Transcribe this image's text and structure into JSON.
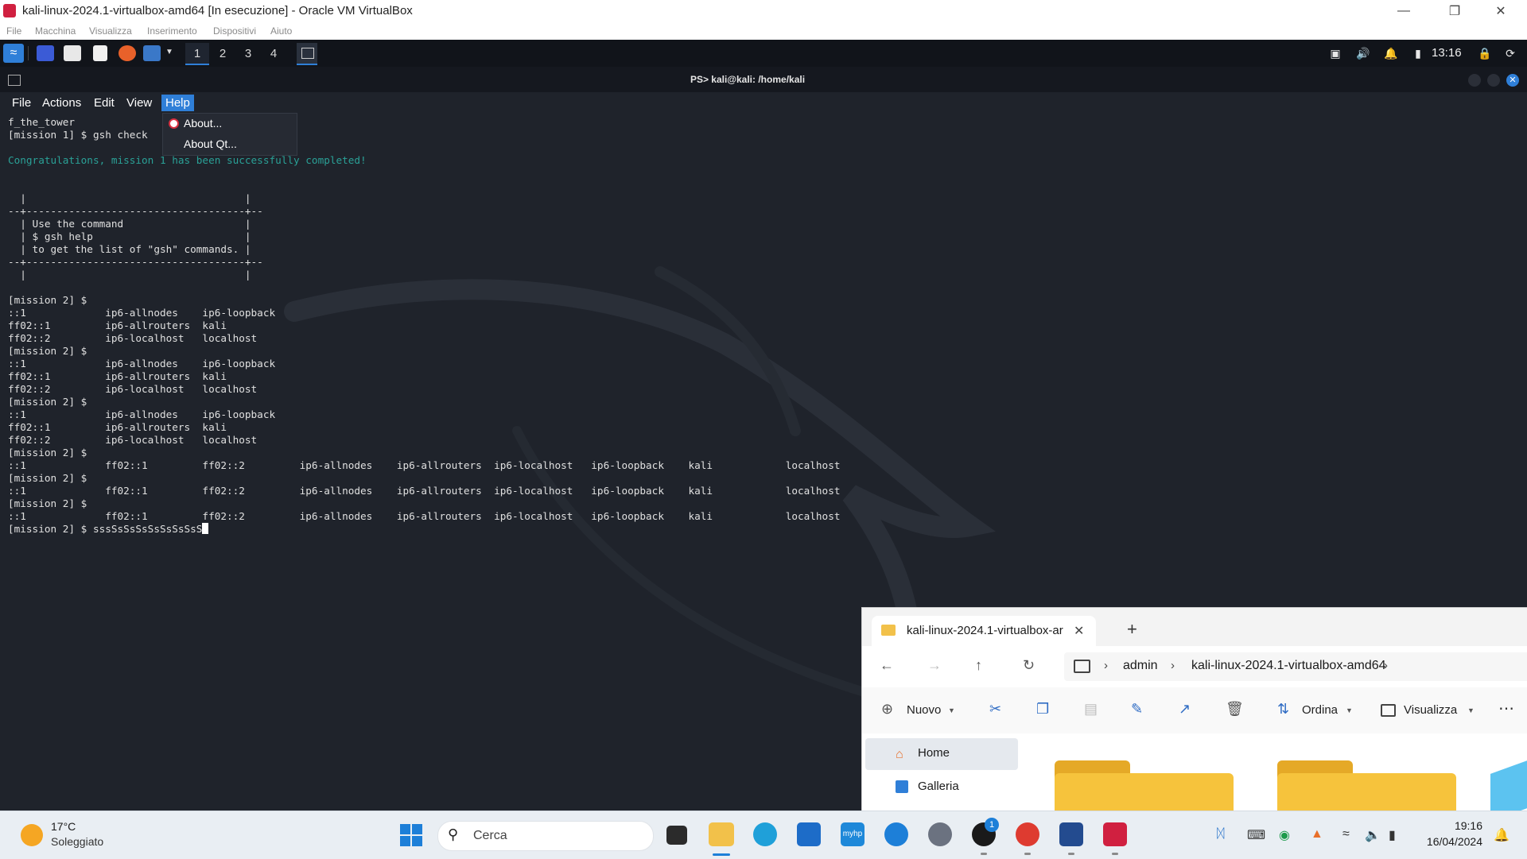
{
  "vbox": {
    "title": "kali-linux-2024.1-virtualbox-amd64 [In esecuzione] - Oracle VM VirtualBox",
    "menu": [
      "File",
      "Macchina",
      "Visualizza",
      "Inserimento",
      "Dispositivi",
      "Aiuto"
    ]
  },
  "kali_panel": {
    "workspaces": [
      "1",
      "2",
      "3",
      "4"
    ],
    "active_workspace": "1",
    "clock": "13:16"
  },
  "terminal": {
    "title": "PS> kali@kali: /home/kali",
    "menu": [
      "File",
      "Actions",
      "Edit",
      "View",
      "Help"
    ],
    "selected_menu": "Help",
    "help_items": [
      "About...",
      "About Qt..."
    ],
    "lines": [
      "f_the_tower",
      "[mission 1] $ gsh check",
      "",
      "Congratulations, mission 1 has been successfully completed!",
      "",
      "",
      "  |                                    |",
      "--+------------------------------------+--",
      "  | Use the command                    |",
      "  | $ gsh help                         |",
      "  | to get the list of \"gsh\" commands. |",
      "--+------------------------------------+--",
      "  |                                    |",
      "",
      "[mission 2] $",
      "::1             ip6-allnodes    ip6-loopback",
      "ff02::1         ip6-allrouters  kali",
      "ff02::2         ip6-localhost   localhost",
      "[mission 2] $",
      "::1             ip6-allnodes    ip6-loopback",
      "ff02::1         ip6-allrouters  kali",
      "ff02::2         ip6-localhost   localhost",
      "[mission 2] $",
      "::1             ip6-allnodes    ip6-loopback",
      "ff02::1         ip6-allrouters  kali",
      "ff02::2         ip6-localhost   localhost",
      "[mission 2] $",
      "::1             ff02::1         ff02::2         ip6-allnodes    ip6-allrouters  ip6-localhost   ip6-loopback    kali            localhost",
      "[mission 2] $",
      "::1             ff02::1         ff02::2         ip6-allnodes    ip6-allrouters  ip6-localhost   ip6-loopback    kali            localhost",
      "[mission 2] $",
      "::1             ff02::1         ff02::2         ip6-allnodes    ip6-allrouters  ip6-localhost   ip6-loopback    kali            localhost"
    ],
    "prompt_line": "[mission 2] $ sssSsSsSsSsSsSsSsS",
    "success_color": "#2aa197"
  },
  "explorer": {
    "tab_title": "kali-linux-2024.1-virtualbox-ar",
    "breadcrumb": [
      "admin",
      "kali-linux-2024.1-virtualbox-amd64"
    ],
    "toolbar": {
      "new": "Nuovo",
      "sort": "Ordina",
      "view": "Visualizza"
    },
    "sidebar": [
      "Home",
      "Galleria"
    ]
  },
  "taskbar": {
    "weather_temp": "17°C",
    "weather_desc": "Soleggiato",
    "search_placeholder": "Cerca",
    "time": "19:16",
    "date": "16/04/2024",
    "whatsapp_badge": "1"
  },
  "colors": {
    "accent": "#2f7fd8",
    "vbox_icon": "#d02040"
  }
}
